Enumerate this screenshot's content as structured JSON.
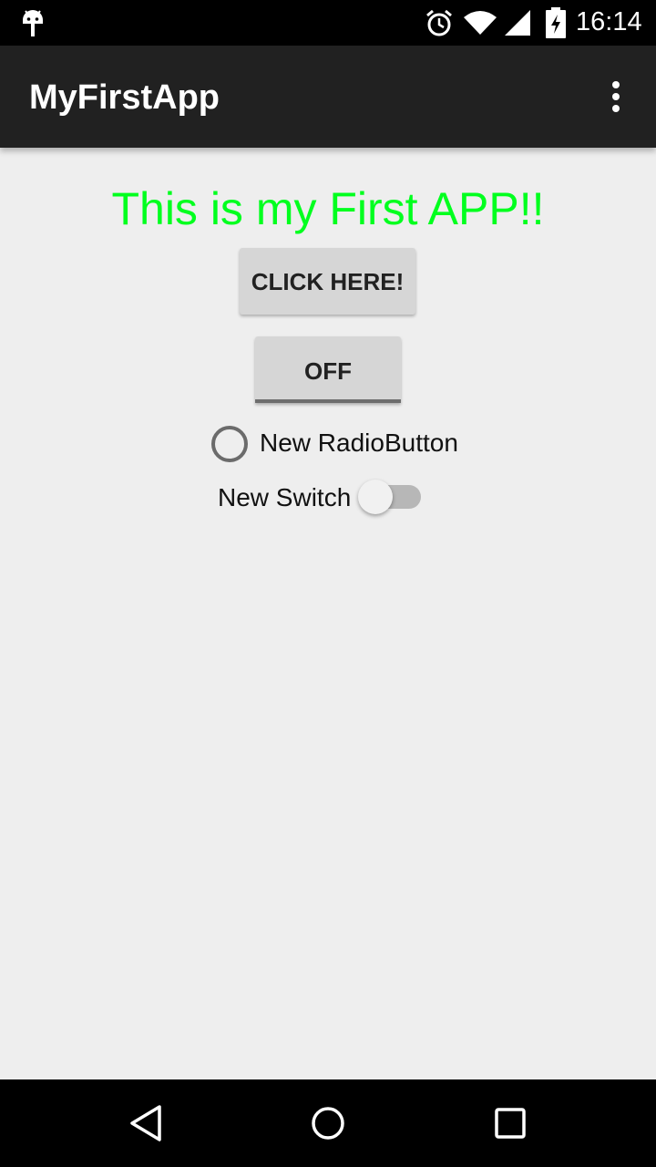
{
  "status_bar": {
    "time": "16:14",
    "icons": [
      "android-debug-icon",
      "alarm-icon",
      "wifi-icon",
      "cell-signal-icon",
      "battery-charging-icon"
    ]
  },
  "app_bar": {
    "title": "MyFirstApp",
    "menu_icon": "overflow-menu-icon"
  },
  "main": {
    "headline": "This is my First APP!!",
    "headline_color": "#00ff1e",
    "click_button_label": "CLICK HERE!",
    "toggle_button_label": "OFF",
    "radio_label": "New RadioButton",
    "radio_checked": false,
    "switch_label": "New Switch",
    "switch_on": false
  },
  "nav_bar": {
    "icons": [
      "back-icon",
      "home-icon",
      "recents-icon"
    ]
  }
}
